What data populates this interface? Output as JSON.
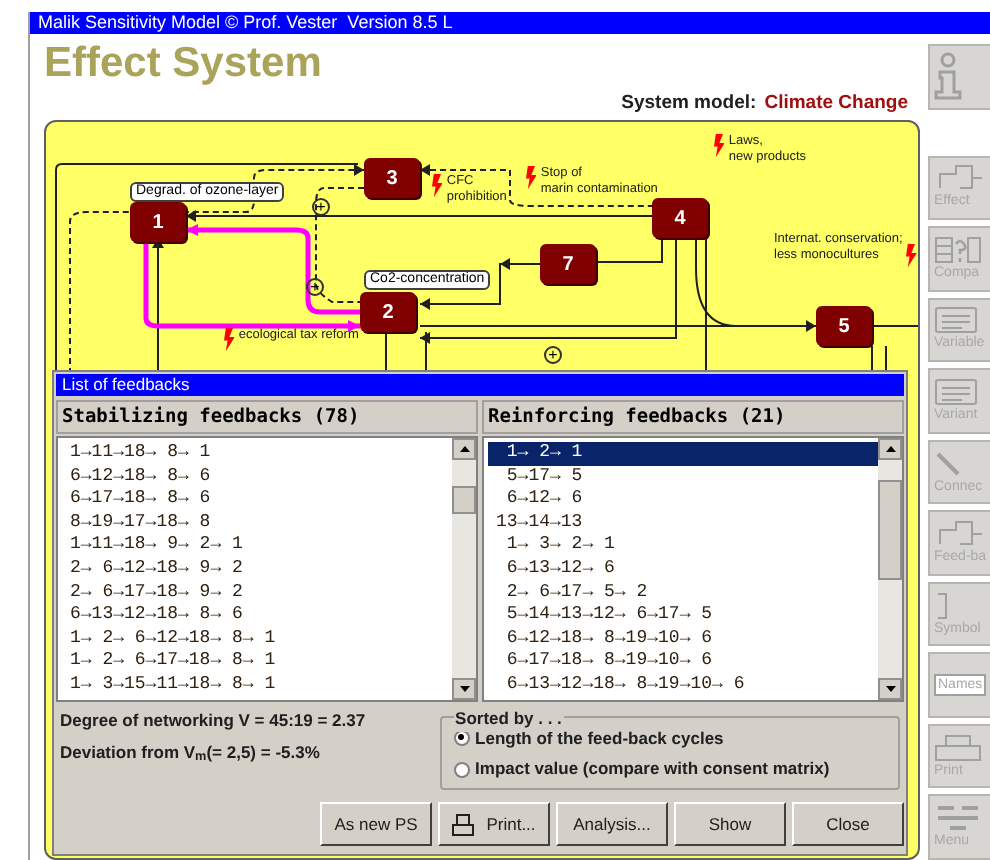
{
  "window": {
    "title": "Malik Sensitivity Model © Prof. Vester  Version 8.5 L"
  },
  "heading": "Effect System",
  "system_model": {
    "label": "System model:",
    "value": "Climate Change"
  },
  "toolbar": [
    {
      "kind": "info"
    },
    {
      "kind": "effects",
      "label": "Effect"
    },
    {
      "kind": "compare",
      "label": "Compa"
    },
    {
      "kind": "variables",
      "label": "Variable"
    },
    {
      "kind": "variants",
      "label": "Variant"
    },
    {
      "kind": "connect",
      "label": "Connec"
    },
    {
      "kind": "feedback",
      "label": "Feed-ba"
    },
    {
      "kind": "symbol",
      "label": "Symbol"
    },
    {
      "kind": "names",
      "label": "Names"
    },
    {
      "kind": "print",
      "label": "Print"
    },
    {
      "kind": "menu",
      "label": "Menu"
    }
  ],
  "diagram": {
    "nodes": [
      {
        "label": "3"
      },
      {
        "label": "1"
      },
      {
        "label": "4"
      },
      {
        "label": "7"
      },
      {
        "label": "2"
      },
      {
        "label": "5"
      }
    ],
    "node_labels": [
      {
        "text": "Degrad. of ozone-layer"
      },
      {
        "text": "Co2-concentration"
      }
    ],
    "interventions": [
      {
        "text": "CFC\nprohibition"
      },
      {
        "text": "Stop of\nmarin contamination"
      },
      {
        "text": "Laws,\nnew products"
      },
      {
        "text": "Internat. conservation;\nless monocultures"
      },
      {
        "text": "ecological tax reform"
      }
    ],
    "signs": [
      {
        "text": "+"
      },
      {
        "text": "+"
      },
      {
        "text": "+"
      }
    ]
  },
  "dialog": {
    "title": "List of feedbacks",
    "lists": [
      {
        "header": "Stabilizing feedbacks (78)",
        "rows": [
          {
            "text": "1→11→18→ 8→ 1",
            "selected": false
          },
          {
            "text": "6→12→18→ 8→ 6",
            "selected": false
          },
          {
            "text": "6→17→18→ 8→ 6",
            "selected": false
          },
          {
            "text": "8→19→17→18→ 8",
            "selected": false
          },
          {
            "text": "1→11→18→ 9→ 2→ 1",
            "selected": false
          },
          {
            "text": "2→ 6→12→18→ 9→ 2",
            "selected": false
          },
          {
            "text": "2→ 6→17→18→ 9→ 2",
            "selected": false
          },
          {
            "text": "6→13→12→18→ 8→ 6",
            "selected": false
          },
          {
            "text": "1→ 2→ 6→12→18→ 8→ 1",
            "selected": false
          },
          {
            "text": "1→ 2→ 6→17→18→ 8→ 1",
            "selected": false
          },
          {
            "text": "1→ 3→15→11→18→ 8→ 1",
            "selected": false
          }
        ]
      },
      {
        "header": "Reinforcing feedbacks (21)",
        "rows": [
          {
            "text": " 1→ 2→ 1",
            "selected": true
          },
          {
            "text": " 5→17→ 5",
            "selected": false
          },
          {
            "text": " 6→12→ 6",
            "selected": false
          },
          {
            "text": "13→14→13",
            "selected": false
          },
          {
            "text": " 1→ 3→ 2→ 1",
            "selected": false
          },
          {
            "text": " 6→13→12→ 6",
            "selected": false
          },
          {
            "text": " 2→ 6→17→ 5→ 2",
            "selected": false
          },
          {
            "text": " 5→14→13→12→ 6→17→ 5",
            "selected": false
          },
          {
            "text": " 6→12→18→ 8→19→10→ 6",
            "selected": false
          },
          {
            "text": " 6→17→18→ 8→19→10→ 6",
            "selected": false
          },
          {
            "text": " 6→13→12→18→ 8→19→10→ 6",
            "selected": false
          }
        ]
      }
    ],
    "stats": [
      "Degree of networking V = 45:19 = 2.37",
      "Deviation from V$_{m}$(= 2,5) = -5.3%"
    ],
    "sort": {
      "title": "Sorted by . . .",
      "options": [
        {
          "label": "Length of the feed-back cycles",
          "selected": true
        },
        {
          "label": "Impact value (compare with consent matrix)",
          "selected": false
        }
      ]
    },
    "buttons": [
      {
        "label": "As new PS",
        "kind": "text"
      },
      {
        "label": "Print...",
        "kind": "print"
      },
      {
        "label": "Analysis...",
        "kind": "text"
      },
      {
        "label": "Show",
        "kind": "text"
      },
      {
        "label": "Close",
        "kind": "text"
      }
    ]
  }
}
